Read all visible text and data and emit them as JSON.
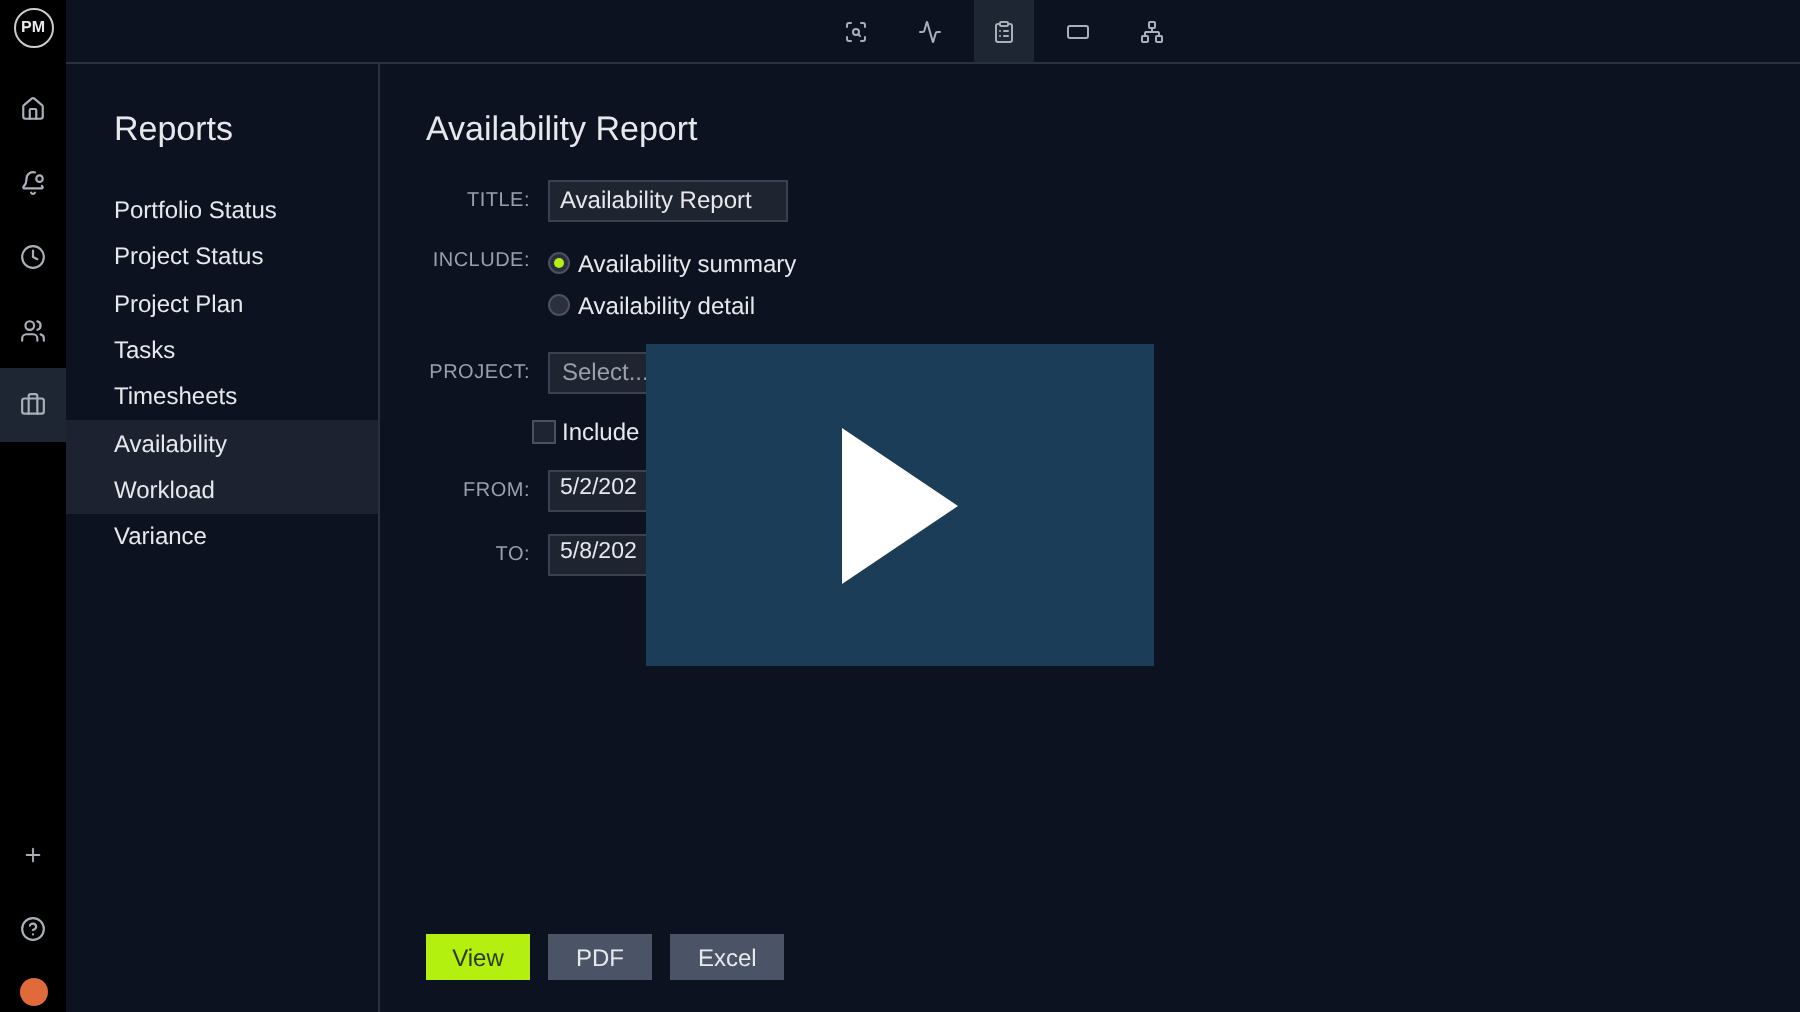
{
  "logo": {
    "text": "PM"
  },
  "rail": [
    {
      "kind": "home",
      "selected": false
    },
    {
      "kind": "bell",
      "selected": false
    },
    {
      "kind": "clock",
      "selected": false
    },
    {
      "kind": "people",
      "selected": false
    },
    {
      "kind": "briefcase",
      "selected": true
    }
  ],
  "toolbar": [
    {
      "kind": "zoom",
      "selected": false
    },
    {
      "kind": "pulse",
      "selected": false
    },
    {
      "kind": "clipboard",
      "selected": true
    },
    {
      "kind": "bar",
      "selected": false
    },
    {
      "kind": "tree",
      "selected": false
    }
  ],
  "sidebar": {
    "title": "Reports",
    "items": [
      {
        "label": "Portfolio Status",
        "selected": false
      },
      {
        "label": "Project Status",
        "selected": false
      },
      {
        "label": "Project Plan",
        "selected": false
      },
      {
        "label": "Tasks",
        "selected": false
      },
      {
        "label": "Timesheets",
        "selected": false
      },
      {
        "label": "Availability",
        "selected": true
      },
      {
        "label": "Workload",
        "selected": true
      },
      {
        "label": "Variance",
        "selected": false
      }
    ]
  },
  "form": {
    "heading": "Availability Report",
    "title_label": "TITLE:",
    "title_value": "Availability Report",
    "include_label": "INCLUDE:",
    "include_options": [
      {
        "label": "Availability summary",
        "selected": true
      },
      {
        "label": "Availability detail",
        "selected": false
      }
    ],
    "project_label": "PROJECT:",
    "project_placeholder": "Select...",
    "closed_projects": {
      "label": "Include",
      "checked": false
    },
    "from_label": "FROM:",
    "from_value": "5/2/202",
    "to_label": "TO:",
    "to_value": "5/8/202"
  },
  "buttons": [
    {
      "label": "View",
      "kind": "primary"
    },
    {
      "label": "PDF",
      "kind": "secondary"
    },
    {
      "label": "Excel",
      "kind": "secondary"
    }
  ]
}
